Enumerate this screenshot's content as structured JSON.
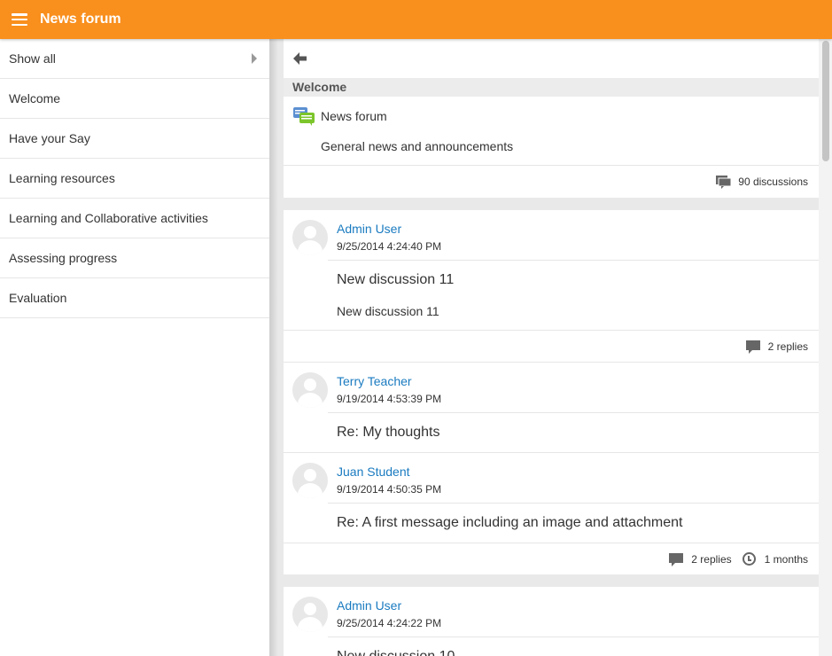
{
  "header": {
    "title": "News forum",
    "menu_icon": "hamburger-icon"
  },
  "sidebar": {
    "items": [
      {
        "label": "Show all",
        "has_arrow": true
      },
      {
        "label": "Welcome"
      },
      {
        "label": "Have your Say"
      },
      {
        "label": "Learning resources"
      },
      {
        "label": "Learning and Collaborative activities"
      },
      {
        "label": "Assessing progress"
      },
      {
        "label": "Evaluation"
      }
    ]
  },
  "main": {
    "section_title": "Welcome",
    "forum": {
      "name": "News forum",
      "description": "General news and announcements",
      "discussions": "90 discussions"
    },
    "discussions": [
      {
        "posts": [
          {
            "author": "Admin User",
            "date": "9/25/2014 4:24:40 PM",
            "subject": "New discussion 11",
            "message": "New discussion 11"
          }
        ],
        "replies": "2 replies"
      },
      {
        "posts": [
          {
            "author": "Terry Teacher",
            "date": "9/19/2014 4:53:39 PM",
            "subject": "Re: My thoughts"
          },
          {
            "author": "Juan Student",
            "date": "9/19/2014 4:50:35 PM",
            "subject": "Re: A first message including an image and attachment"
          }
        ],
        "replies": "2 replies",
        "age": "1 months"
      },
      {
        "posts": [
          {
            "author": "Admin User",
            "date": "9/25/2014 4:24:22 PM",
            "subject": "New discussion 10"
          }
        ]
      }
    ]
  },
  "colors": {
    "header": "#f98f1d",
    "link": "#1a7bc0"
  }
}
